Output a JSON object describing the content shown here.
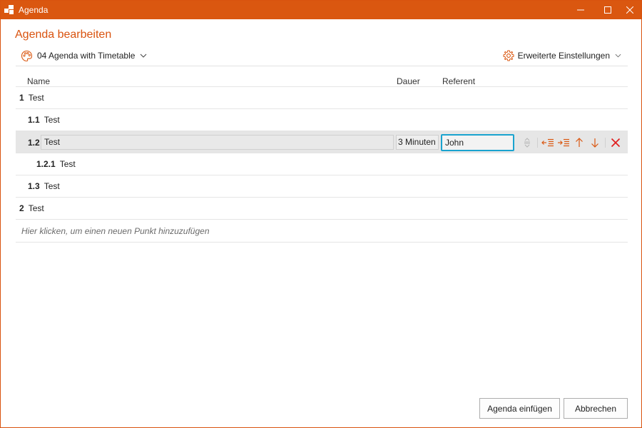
{
  "window": {
    "title": "Agenda"
  },
  "dialog": {
    "heading": "Agenda bearbeiten",
    "template_label": "04 Agenda with Timetable",
    "advanced_label": "Erweiterte Einstellungen"
  },
  "columns": {
    "name": "Name",
    "dauer": "Dauer",
    "referent": "Referent"
  },
  "items": [
    {
      "num": "1",
      "title": "Test"
    },
    {
      "num": "1.1",
      "title": "Test"
    },
    {
      "num": "1.2",
      "title": "Test",
      "dauer": "3 Minuten",
      "referent": "John"
    },
    {
      "num": "1.2.1",
      "title": "Test"
    },
    {
      "num": "1.3",
      "title": "Test"
    },
    {
      "num": "2",
      "title": "Test"
    }
  ],
  "add_hint": "Hier klicken, um einen neuen Punkt hinzuzufügen",
  "buttons": {
    "insert": "Agenda einfügen",
    "cancel": "Abbrechen"
  },
  "colors": {
    "accent": "#da5710",
    "focus": "#1aa3cf",
    "delete": "#e02020"
  }
}
